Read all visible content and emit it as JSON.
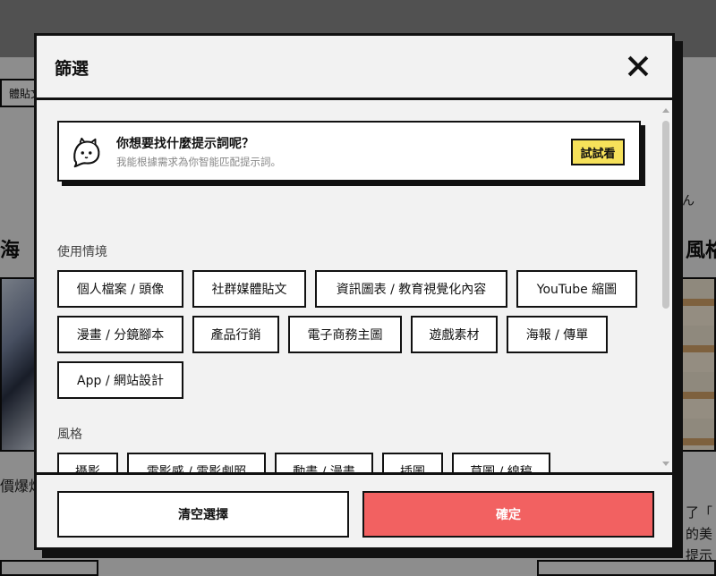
{
  "background": {
    "tab_label": "體貼文",
    "heading_left": "海",
    "heading_right": "風格",
    "side_note": "ん",
    "caption_left": "價爆炸",
    "caption_right_1": "了「",
    "caption_right_2": "的美",
    "caption_right_3": "提示"
  },
  "modal": {
    "title": "篩選",
    "suggest": {
      "title": "你想要找什麼提示詞呢？",
      "subtitle": "我能根據需求為你智能匹配提示詞。",
      "try_label": "試試看"
    },
    "sections": [
      {
        "label": "使用情境",
        "chips": [
          "個人檔案 / 頭像",
          "社群媒體貼文",
          "資訊圖表 / 教育視覺化內容",
          "YouTube 縮圖",
          "漫畫 / 分鏡腳本",
          "產品行銷",
          "電子商務主圖",
          "遊戲素材",
          "海報 / 傳單",
          "App / 網站設計"
        ]
      },
      {
        "label": "風格",
        "chips": [
          "攝影",
          "電影感 / 電影劇照",
          "動畫 / 漫畫",
          "插圖",
          "草圖 / 線稿"
        ]
      }
    ],
    "footer": {
      "clear_label": "清空選擇",
      "confirm_label": "確定"
    }
  },
  "colors": {
    "accent_yellow": "#f6e15a",
    "confirm_red": "#f26161"
  }
}
